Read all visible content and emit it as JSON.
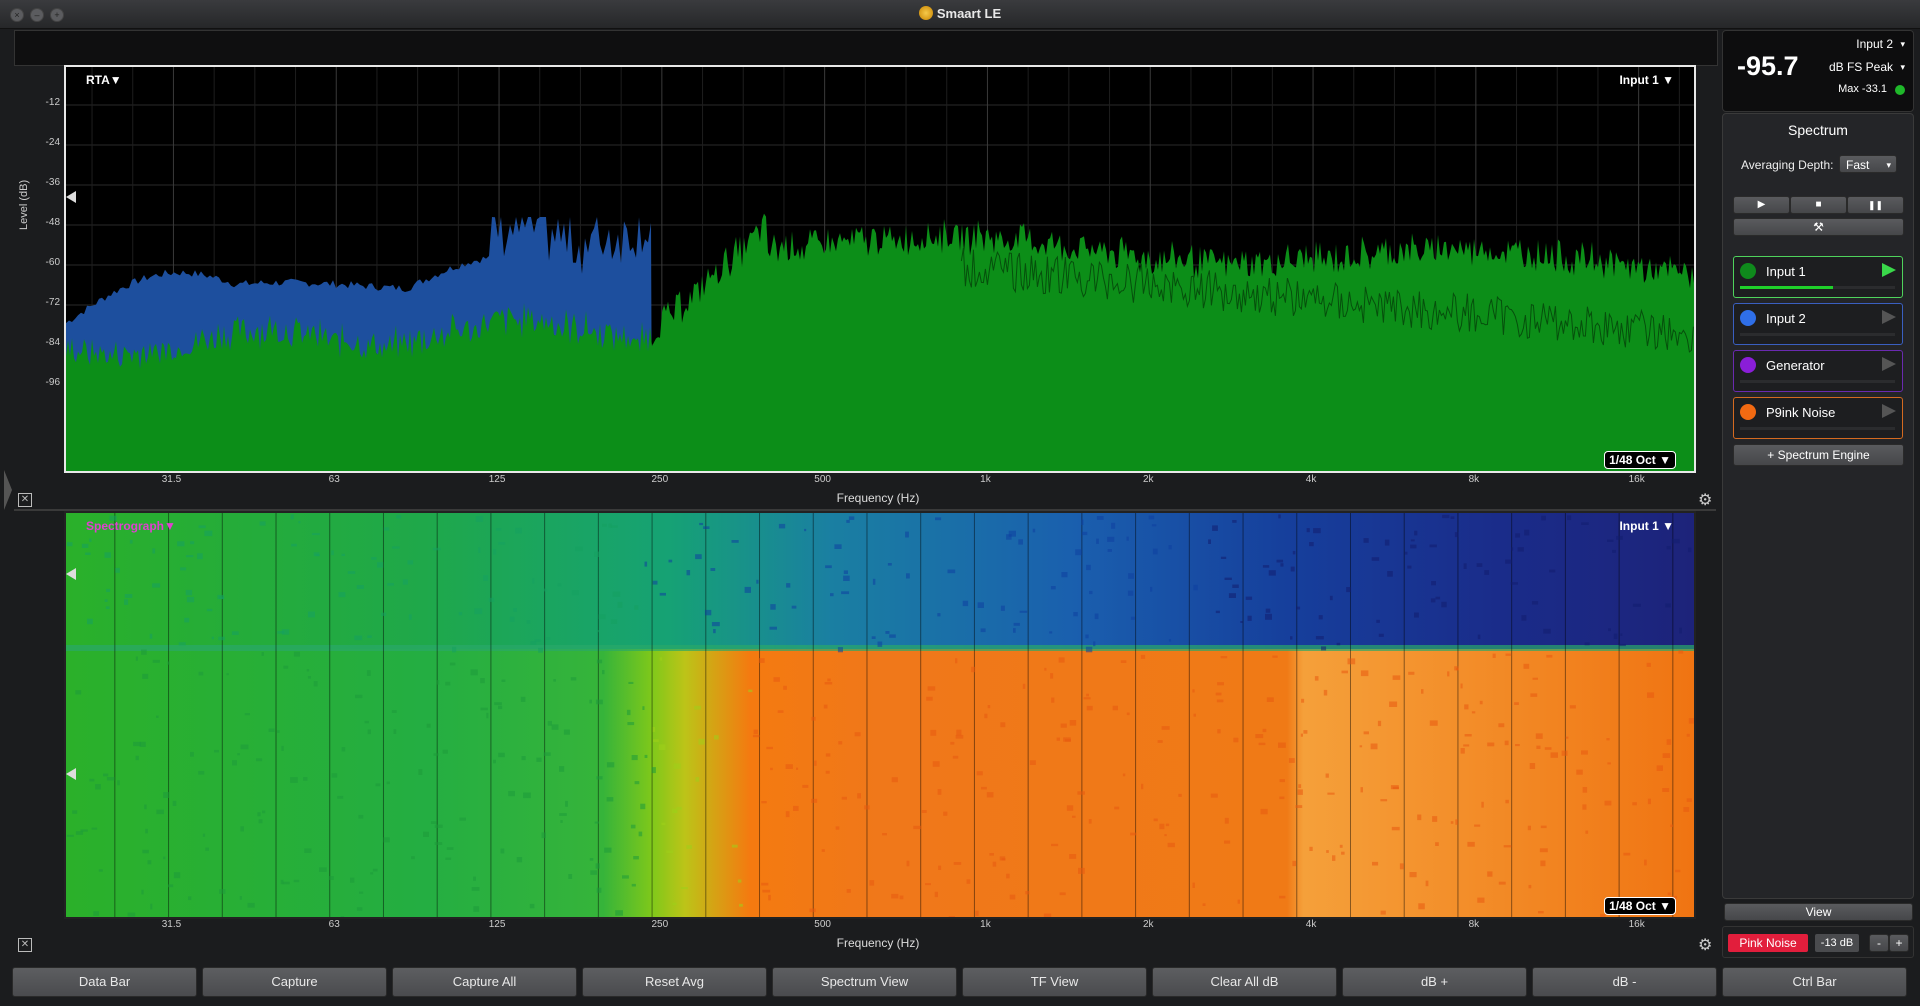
{
  "window": {
    "title": "Smaart LE"
  },
  "rta_plot": {
    "mode_label": "RTA▼",
    "input_label": "Input 1 ▼",
    "resolution_label": "1/48 Oct ▼",
    "y_axis_label": "Level (dB)",
    "y_ticks": [
      "-12",
      "-24",
      "-36",
      "-48",
      "-60",
      "-72",
      "-84",
      "-96"
    ],
    "x_axis_label": "Frequency (Hz)",
    "x_ticks": [
      "31.5",
      "63",
      "125",
      "250",
      "500",
      "1k",
      "2k",
      "4k",
      "8k",
      "16k"
    ]
  },
  "spectrograph_plot": {
    "mode_label": "Spectrograph▼",
    "input_label": "Input 1 ▼",
    "resolution_label": "1/48 Oct ▼",
    "x_axis_label": "Frequency (Hz)",
    "x_ticks": [
      "31.5",
      "63",
      "125",
      "250",
      "500",
      "1k",
      "2k",
      "4k",
      "8k",
      "16k"
    ]
  },
  "meter": {
    "value": "-95.7",
    "input": "Input 2",
    "units": "dB FS Peak",
    "max": "Max -33.1"
  },
  "spectrum_panel": {
    "title": "Spectrum",
    "averaging_label": "Averaging Depth:",
    "averaging_value": "Fast",
    "play_icon": "▶",
    "stop_icon": "■",
    "pause_icon": "❚❚",
    "tools_icon": "⚒",
    "engines": [
      {
        "label": "Input 1",
        "color": "#0f8a1c",
        "border": "#4fd35c",
        "level": 0.6
      },
      {
        "label": "Input 2",
        "color": "#2f6fe8",
        "border": "#3a5fc0",
        "level": 0.0
      },
      {
        "label": "Generator",
        "color": "#8a1ed8",
        "border": "#6a2ab0",
        "level": 0.0
      },
      {
        "label": "P9ink Noise",
        "color": "#f26a12",
        "border": "#d46a20",
        "level": 0.0
      }
    ],
    "add_engine": "+ Spectrum Engine",
    "view_label": "View",
    "pink_noise_label": "Pink Noise",
    "gen_level": "-13 dB",
    "minus": "-",
    "plus": "+"
  },
  "bottom_bar": {
    "buttons": [
      "Data Bar",
      "Capture",
      "Capture All",
      "Reset Avg",
      "Spectrum View",
      "TF View",
      "Clear All dB",
      "dB +",
      "dB -",
      "Ctrl Bar"
    ]
  },
  "colors": {
    "input1": "#0f8a1c",
    "input2": "#1c4fa0",
    "pink_button": "#e21e3c"
  }
}
